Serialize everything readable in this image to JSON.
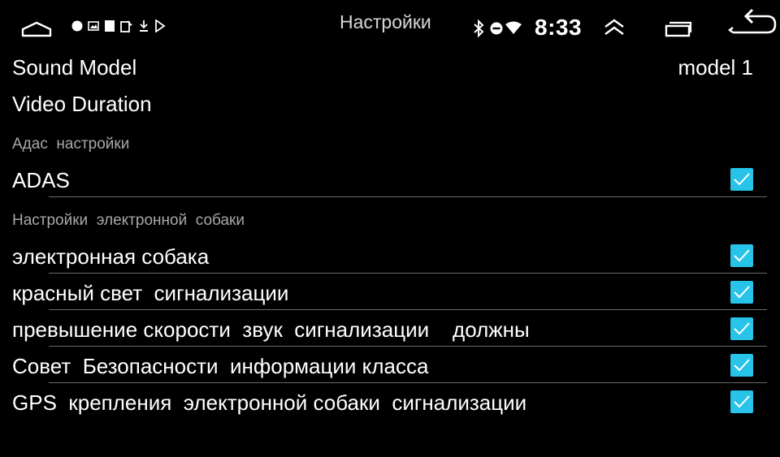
{
  "status_bar": {
    "title": "Настройки",
    "time": "8:33",
    "icons": {
      "home": "home-icon",
      "notifications": [
        "dot-icon",
        "image-icon",
        "square-icon",
        "app-icon",
        "download-icon",
        "play-store-icon"
      ],
      "bluetooth": "bluetooth-icon",
      "dnd": "do-not-disturb-icon",
      "wifi": "wifi-icon",
      "expand": "double-chevron-up-icon",
      "recents": "recents-icon",
      "back": "back-icon"
    }
  },
  "settings": {
    "sound_model": {
      "label": "Sound Model",
      "value": "model 1"
    },
    "video_duration": {
      "label": "Video Duration"
    },
    "adas_section": "Адас  настройки",
    "adas": {
      "label": "ADAS",
      "checked": true
    },
    "edog_section": "Настройки  электронной  собаки",
    "items": [
      {
        "label": "электронная собака",
        "checked": true
      },
      {
        "label": "красный свет  сигнализации",
        "checked": true
      },
      {
        "label": "превышение скорости  звук  сигнализации    должны",
        "checked": true
      },
      {
        "label": "Совет  Безопасности  информации класса",
        "checked": true
      },
      {
        "label": "GPS  крепления  электронной собаки  сигнализации",
        "checked": true
      }
    ]
  },
  "colors": {
    "background": "#000000",
    "checkbox_accent": "#27c3e8",
    "section_text": "#a8a8a8",
    "divider": "#6a6a6a"
  }
}
